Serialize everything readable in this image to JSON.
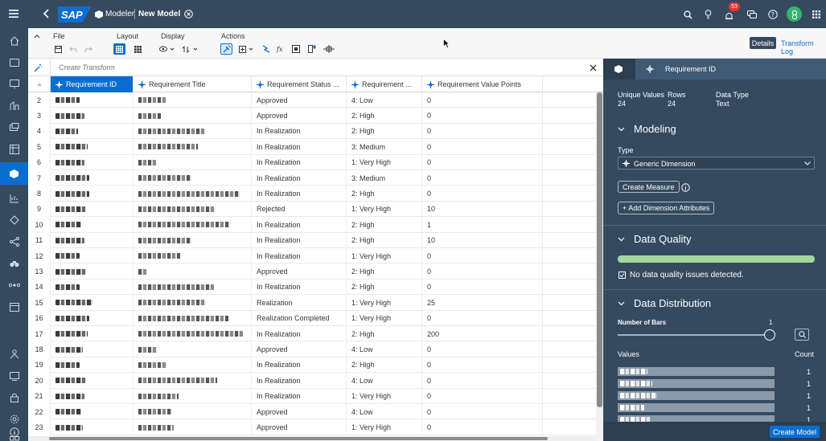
{
  "shell": {
    "logo": "SAP",
    "app": "Modeler",
    "model": "New Model",
    "notif_count": "53"
  },
  "toolbar": {
    "groups": [
      "File",
      "Layout",
      "Display",
      "Actions"
    ],
    "details_label": "Details",
    "transform_log_label": "Transform Log"
  },
  "formula": {
    "placeholder": "Create Transform"
  },
  "columns": [
    {
      "label": "Requirement ID"
    },
    {
      "label": "Requirement Title"
    },
    {
      "label": "Requirement Status ..."
    },
    {
      "label": "Requirement ..."
    },
    {
      "label": "Requirement Value Points"
    }
  ],
  "rows": [
    {
      "n": "2",
      "status": "Approved",
      "prio": "4: Low",
      "pts": "0"
    },
    {
      "n": "3",
      "status": "Approved",
      "prio": "2: High",
      "pts": "0"
    },
    {
      "n": "4",
      "status": "In Realization",
      "prio": "2: High",
      "pts": "0"
    },
    {
      "n": "5",
      "status": "In Realization",
      "prio": "3: Medium",
      "pts": "0"
    },
    {
      "n": "6",
      "status": "In Realization",
      "prio": "1: Very High",
      "pts": "0"
    },
    {
      "n": "7",
      "status": "In Realization",
      "prio": "3: Medium",
      "pts": "0"
    },
    {
      "n": "8",
      "status": "In Realization",
      "prio": "2: High",
      "pts": "0"
    },
    {
      "n": "9",
      "status": "Rejected",
      "prio": "1: Very High",
      "pts": "10"
    },
    {
      "n": "10",
      "status": "In Realization",
      "prio": "2: High",
      "pts": "1"
    },
    {
      "n": "11",
      "status": "In Realization",
      "prio": "2: High",
      "pts": "10"
    },
    {
      "n": "12",
      "status": "In Realization",
      "prio": "1: Very High",
      "pts": "0"
    },
    {
      "n": "13",
      "status": "Approved",
      "prio": "2: High",
      "pts": "0"
    },
    {
      "n": "14",
      "status": "In Realization",
      "prio": "2: High",
      "pts": "0"
    },
    {
      "n": "15",
      "status": "Realization",
      "prio": "1: Very High",
      "pts": "25"
    },
    {
      "n": "16",
      "status": "Realization Completed",
      "prio": "1: Very High",
      "pts": "0"
    },
    {
      "n": "17",
      "status": "In Realization",
      "prio": "2: High",
      "pts": "200"
    },
    {
      "n": "18",
      "status": "Approved",
      "prio": "4: Low",
      "pts": "0"
    },
    {
      "n": "19",
      "status": "In Realization",
      "prio": "2: High",
      "pts": "0"
    },
    {
      "n": "20",
      "status": "In Realization",
      "prio": "4: Low",
      "pts": "0"
    },
    {
      "n": "21",
      "status": "In Realization",
      "prio": "1: Very High",
      "pts": "0"
    },
    {
      "n": "22",
      "status": "Approved",
      "prio": "4: Low",
      "pts": "0"
    },
    {
      "n": "23",
      "status": "Approved",
      "prio": "1: Very High",
      "pts": "0"
    }
  ],
  "panel": {
    "title": "Requirement ID",
    "stats": {
      "unique_label": "Unique Values",
      "unique": "24",
      "rows_label": "Rows",
      "rows": "24",
      "type_label": "Data Type",
      "type": "Text"
    },
    "modeling": {
      "title": "Modeling",
      "type_label": "Type",
      "type_value": "Generic Dimension",
      "create_measure": "Create Measure",
      "add_attr": "+ Add Dimension Attributes"
    },
    "quality": {
      "title": "Data Quality",
      "message": "No data quality issues detected.",
      "progress": 1.0
    },
    "distribution": {
      "title": "Data Distribution",
      "bars_label": "Number of Bars",
      "bars_value": "1",
      "values_label": "Values",
      "count_label": "Count",
      "counts": [
        "1",
        "1",
        "1",
        "1",
        "1"
      ]
    },
    "create_model": "Create Model"
  },
  "colors": {
    "shell": "#354a5f",
    "accent": "#0a6ed1",
    "quality_bar": "#a5d6a0"
  }
}
